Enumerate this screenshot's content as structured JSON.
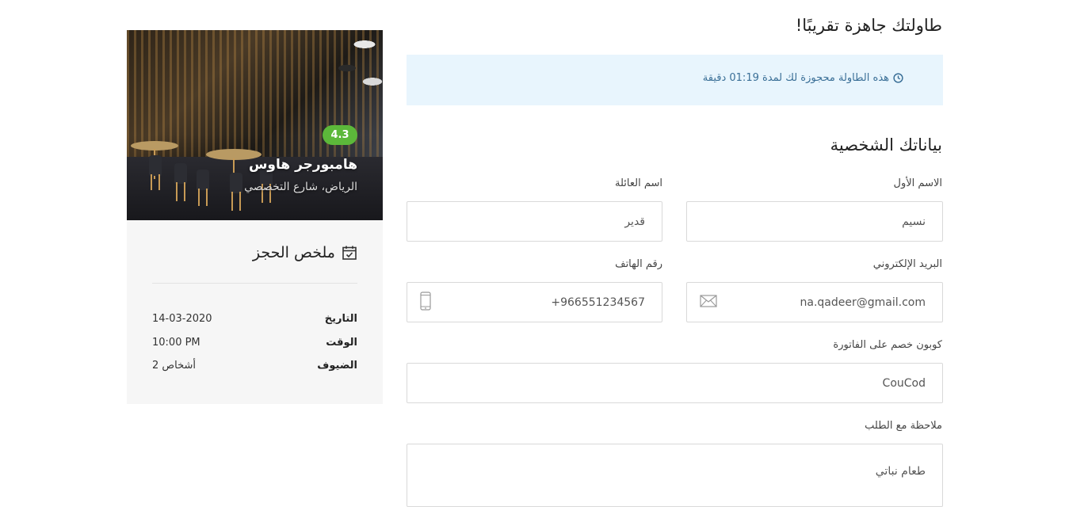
{
  "restaurant": {
    "rating": "4.3",
    "name": "هامبورجر هاوس",
    "location": "الرياض، شارع التخصصي"
  },
  "summary": {
    "title": "ملخص الحجز",
    "rows": [
      {
        "label": "التاريخ",
        "value": "14-03-2020"
      },
      {
        "label": "الوقت",
        "value": "10:00 PM"
      },
      {
        "label": "الضيوف",
        "value": "2 أشخاص"
      }
    ]
  },
  "page": {
    "heading": "طاولتك جاهزة تقريبًا!",
    "alert": "هذه الطاولة محجوزة لك لمدة 01:19 دقيقة",
    "section_title": "بياناتك الشخصية"
  },
  "form": {
    "first_name": {
      "label": "الاسم الأول",
      "value": "نسيم"
    },
    "last_name": {
      "label": "اسم العائلة",
      "value": "قدير"
    },
    "email": {
      "label": "البريد الإلكتروني",
      "value": "na.qadeer@gmail.com"
    },
    "phone": {
      "label": "رقم الهاتف",
      "value": "966551234567+"
    },
    "coupon": {
      "label": "كوبون خصم على الفاتورة",
      "value": "CouCod"
    },
    "note": {
      "label": "ملاحظة مع الطلب",
      "value": "طعام نباتي"
    }
  },
  "icons": {
    "calendar": "calendar-check-icon",
    "clock": "clock-icon",
    "mail": "envelope-icon",
    "phone": "mobile-phone-icon"
  },
  "colors": {
    "rating_badge": "#5cb83a",
    "alert_bg": "#e8f5fd",
    "alert_text": "#3a6f97"
  }
}
